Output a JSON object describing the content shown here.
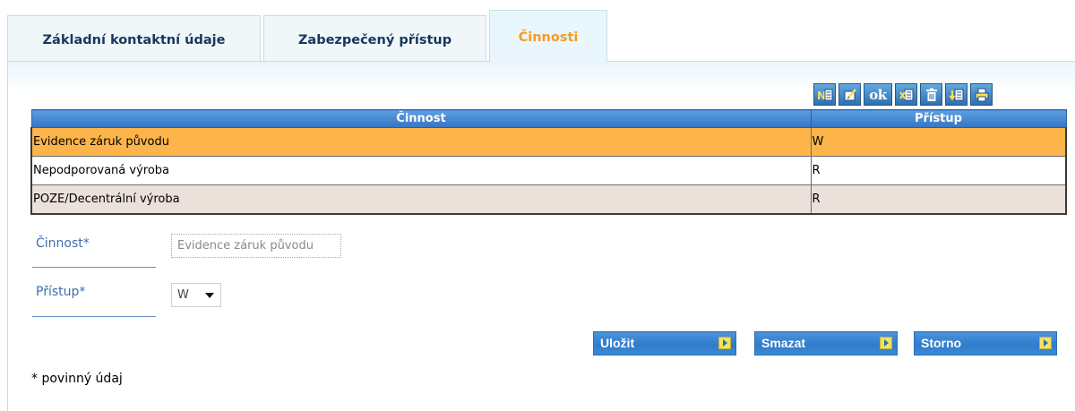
{
  "tabs": [
    {
      "label": "Základní kontaktní údaje",
      "active": false
    },
    {
      "label": "Zabezpečený přístup",
      "active": false
    },
    {
      "label": "Činnosti",
      "active": true
    }
  ],
  "toolbar": {
    "buttons": [
      {
        "name": "new-record-icon"
      },
      {
        "name": "edit-record-icon"
      },
      {
        "name": "ok-icon",
        "text": "ok"
      },
      {
        "name": "excel-export-icon"
      },
      {
        "name": "delete-icon"
      },
      {
        "name": "import-icon"
      },
      {
        "name": "print-icon"
      }
    ]
  },
  "table": {
    "columns": [
      "Činnost",
      "Přístup"
    ],
    "rows": [
      {
        "cinnost": "Evidence záruk původu",
        "pristup": "W",
        "selected": true
      },
      {
        "cinnost": "Nepodporovaná výroba",
        "pristup": "R",
        "selected": false
      },
      {
        "cinnost": "POZE/Decentrální výroba",
        "pristup": "R",
        "selected": false
      }
    ]
  },
  "form": {
    "cinnost_label": "Činnost*",
    "cinnost_value": "Evidence záruk původu",
    "pristup_label": "Přístup*",
    "pristup_value": "W"
  },
  "actions": {
    "save": "Uložit",
    "delete": "Smazat",
    "cancel": "Storno"
  },
  "footnote": "* povinný údaj",
  "colors": {
    "accent_tab": "#f29c28",
    "selected_row": "#fdb44a",
    "header_blue": "#3576c4",
    "label_blue": "#3d6fb0"
  }
}
